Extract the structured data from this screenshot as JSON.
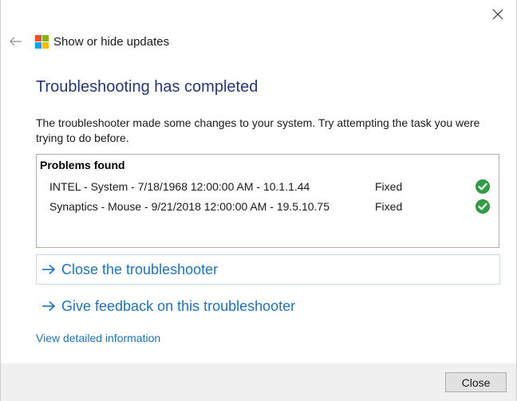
{
  "window": {
    "title": "Show or hide updates"
  },
  "icons": {
    "close": "close-icon",
    "back": "back-arrow-icon",
    "app": "windows-logo-icon",
    "check": "green-check-icon",
    "link_arrow": "arrow-right-icon"
  },
  "colors": {
    "heading": "#24367f",
    "link": "#1a74c4",
    "logo_red": "#f25022",
    "logo_green": "#7fba00",
    "logo_blue": "#00a4ef",
    "logo_yellow": "#ffb900",
    "check_green": "#2ea043"
  },
  "main": {
    "heading": "Troubleshooting has completed",
    "description": "The troubleshooter made some changes to your system. Try attempting the task you were trying to do before."
  },
  "problems": {
    "header": "Problems found",
    "items": [
      {
        "name": "INTEL - System - 7/18/1968 12:00:00 AM - 10.1.1.44",
        "status": "Fixed"
      },
      {
        "name": "Synaptics - Mouse - 9/21/2018 12:00:00 AM - 19.5.10.75",
        "status": "Fixed"
      }
    ]
  },
  "links": {
    "close_troubleshooter": "Close the troubleshooter",
    "give_feedback": "Give feedback on this troubleshooter",
    "view_details": "View detailed information"
  },
  "footer": {
    "close_button": "Close"
  }
}
